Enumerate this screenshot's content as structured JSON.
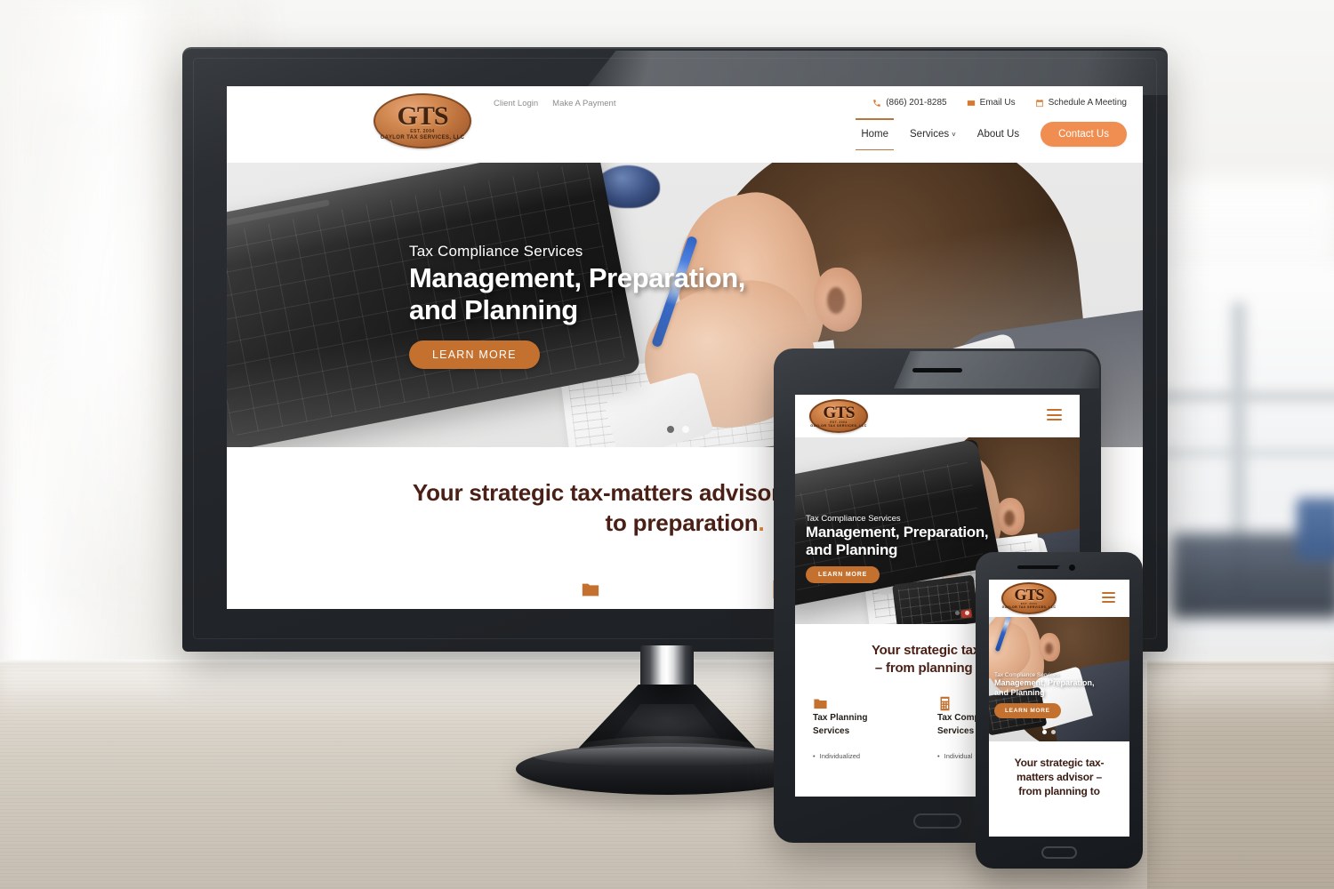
{
  "site": {
    "brand": {
      "logo_main": "GTS",
      "logo_est": "EST. 2004",
      "logo_sub": "GAYLOR TAX SERVICES, LLC"
    },
    "utility_links": [
      {
        "label": "Client Login"
      },
      {
        "label": "Make A Payment"
      }
    ],
    "contact_items": [
      {
        "icon": "phone-icon",
        "label": "(866) 201-8285"
      },
      {
        "icon": "envelope-icon",
        "label": "Email Us"
      },
      {
        "icon": "calendar-icon",
        "label": "Schedule A Meeting"
      }
    ],
    "nav": [
      {
        "label": "Home",
        "active": true
      },
      {
        "label": "Services",
        "caret": "˅",
        "active": false
      },
      {
        "label": "About Us",
        "active": false
      }
    ],
    "cta_button": "Contact Us",
    "hero": {
      "kicker": "Tax Compliance Services",
      "title_line1": "Management, Preparation,",
      "title_line2": "and Planning",
      "button": "LEARN MORE",
      "slide_count": 2,
      "active_slide": 1
    },
    "intro": {
      "heading_part1": "Your strategic tax-matters advisor – from planning to preparation",
      "heading_dot": "."
    },
    "services": [
      {
        "icon": "folder-icon",
        "title": "Tax Planning Services",
        "bullets": [
          "Individualized"
        ]
      },
      {
        "icon": "calculator-icon",
        "title": "Tax Compliance Services",
        "bullets": [
          "Individual"
        ]
      }
    ],
    "tablet": {
      "heading_line1": "Your strategic tax-ma",
      "heading_line2": "– from planning to p"
    },
    "phone": {
      "heading_line1": "Your strategic tax-",
      "heading_line2": "matters advisor –",
      "heading_line3": "from planning to"
    }
  },
  "colors": {
    "brand_orange": "#c4702f",
    "cta_orange": "#ef8e50",
    "heading_maroon": "#4a1f16",
    "logo_copper": "#b86a33",
    "bezel_dark": "#23262a"
  }
}
